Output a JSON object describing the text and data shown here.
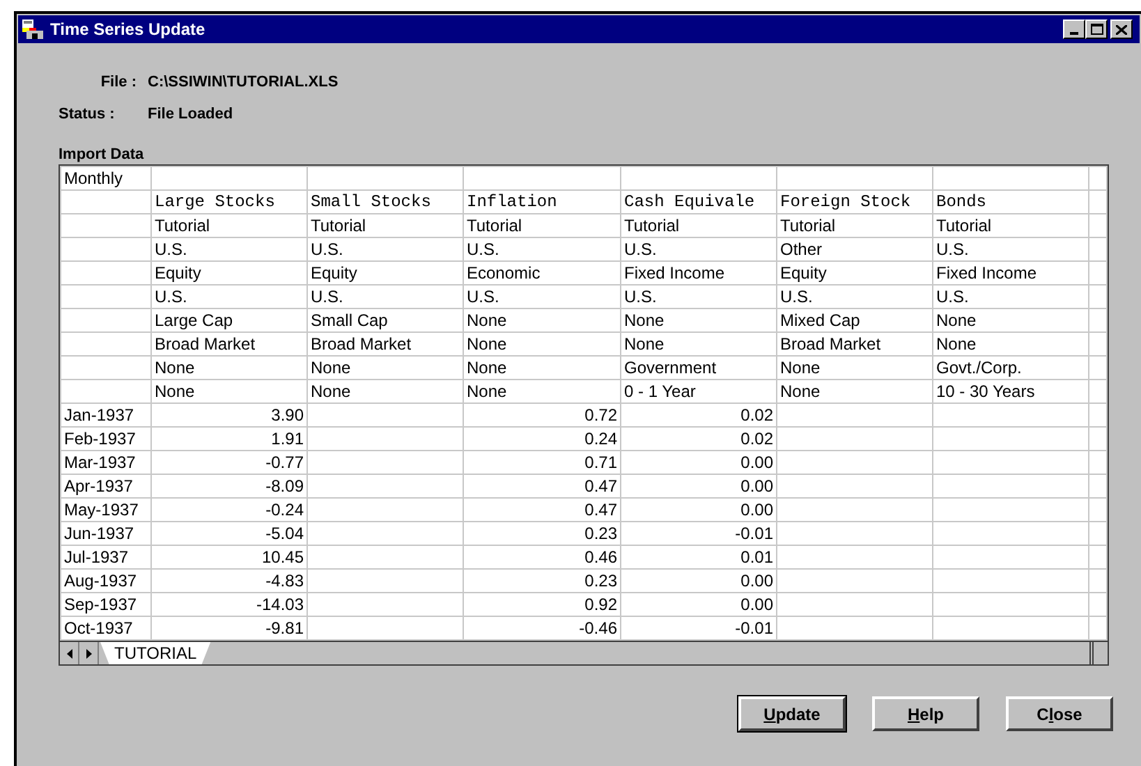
{
  "window": {
    "title": "Time Series Update"
  },
  "file": {
    "label": "File :",
    "value": "C:\\SSIWIN\\TUTORIAL.XLS"
  },
  "status": {
    "label": "Status :",
    "value": "File Loaded"
  },
  "import_label": "Import Data",
  "table": {
    "corner": "Monthly",
    "columns": [
      {
        "header": "Large Stocks",
        "attributes": [
          "Tutorial",
          "U.S.",
          "Equity",
          "U.S.",
          "Large Cap",
          "Broad Market",
          "None",
          "None"
        ],
        "values": [
          "3.90",
          "1.91",
          "-0.77",
          "-8.09",
          "-0.24",
          "-5.04",
          "10.45",
          "-4.83",
          "-14.03",
          "-9.81"
        ]
      },
      {
        "header": "Small Stocks",
        "attributes": [
          "Tutorial",
          "U.S.",
          "Equity",
          "U.S.",
          "Small Cap",
          "Broad Market",
          "None",
          "None"
        ]
      },
      {
        "header": "Inflation",
        "attributes": [
          "Tutorial",
          "U.S.",
          "Economic",
          "U.S.",
          "None",
          "None",
          "None",
          "None"
        ],
        "values": [
          "0.72",
          "0.24",
          "0.71",
          "0.47",
          "0.47",
          "0.23",
          "0.46",
          "0.23",
          "0.92",
          "-0.46"
        ]
      },
      {
        "header": "Cash Equivale",
        "attributes": [
          "Tutorial",
          "U.S.",
          "Fixed Income",
          "U.S.",
          "None",
          "None",
          "Government",
          "0 - 1 Year"
        ],
        "values": [
          "0.02",
          "0.02",
          "0.00",
          "0.00",
          "0.00",
          "-0.01",
          "0.01",
          "0.00",
          "0.00",
          "-0.01"
        ]
      },
      {
        "header": "Foreign Stock",
        "attributes": [
          "Tutorial",
          "Other",
          "Equity",
          "U.S.",
          "Mixed Cap",
          "Broad Market",
          "None",
          "None"
        ]
      },
      {
        "header": "Bonds",
        "attributes": [
          "Tutorial",
          "U.S.",
          "Fixed Income",
          "U.S.",
          "None",
          "None",
          "Govt./Corp.",
          "10 - 30 Years"
        ]
      }
    ],
    "dates": [
      "Jan-1937",
      "Feb-1937",
      "Mar-1937",
      "Apr-1937",
      "May-1937",
      "Jun-1937",
      "Jul-1937",
      "Aug-1937",
      "Sep-1937",
      "Oct-1937"
    ],
    "sheet_tab": "TUTORIAL"
  },
  "buttons": [
    {
      "key": "U",
      "post": "pdate",
      "default": true
    },
    {
      "key": "H",
      "post": "elp",
      "default": false
    },
    {
      "pre": "C",
      "key": "l",
      "post": "ose",
      "default": false
    }
  ]
}
